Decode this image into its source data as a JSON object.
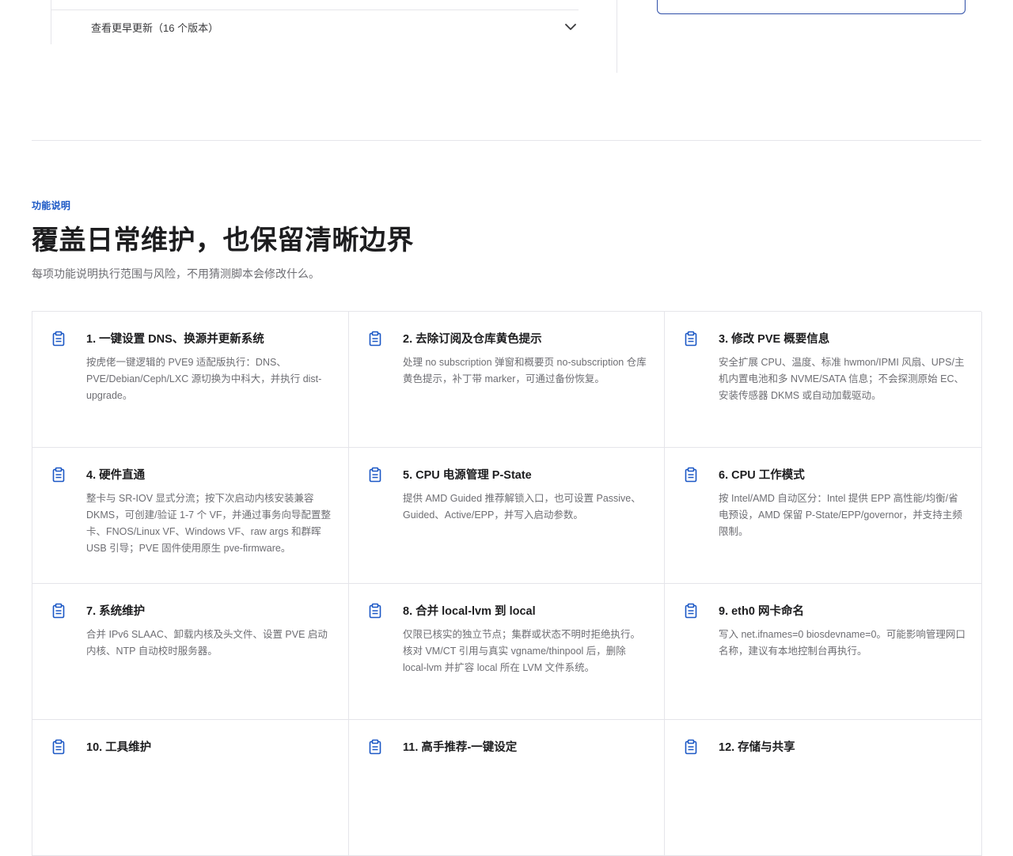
{
  "versions": {
    "older_label": "查看更早更新（16 个版本）",
    "toggle_icon": "chevron-down-icon"
  },
  "features": {
    "eyebrow": "功能说明",
    "title": "覆盖日常维护，也保留清晰边界",
    "subtitle": "每项功能说明执行范围与风险，不用猜测脚本会修改什么。",
    "icon": "clipboard-icon",
    "accent_color": "#1a57c5",
    "cards": [
      {
        "title": "1. 一键设置 DNS、换源并更新系统",
        "desc": "按虎佬一键逻辑的 PVE9 适配版执行：DNS、PVE/Debian/Ceph/LXC 源切换为中科大，并执行 dist-upgrade。"
      },
      {
        "title": "2. 去除订阅及仓库黄色提示",
        "desc": "处理 no subscription 弹窗和概要页 no-subscription 仓库黄色提示，补丁带 marker，可通过备份恢复。"
      },
      {
        "title": "3. 修改 PVE 概要信息",
        "desc": "安全扩展 CPU、温度、标准 hwmon/IPMI 风扇、UPS/主机内置电池和多 NVME/SATA 信息；不会探测原始 EC、安装传感器 DKMS 或自动加载驱动。"
      },
      {
        "title": "4. 硬件直通",
        "desc": "整卡与 SR-IOV 显式分流；按下次启动内核安装兼容 DKMS，可创建/验证 1-7 个 VF，并通过事务向导配置整卡、FNOS/Linux VF、Windows VF、raw args 和群晖 USB 引导；PVE 固件使用原生 pve-firmware。"
      },
      {
        "title": "5. CPU 电源管理 P-State",
        "desc": "提供 AMD Guided 推荐解锁入口，也可设置 Passive、Guided、Active/EPP，并写入启动参数。"
      },
      {
        "title": "6. CPU 工作模式",
        "desc": "按 Intel/AMD 自动区分：Intel 提供 EPP 高性能/均衡/省电预设，AMD 保留 P-State/EPP/governor，并支持主频限制。"
      },
      {
        "title": "7. 系统维护",
        "desc": "合并 IPv6 SLAAC、卸载内核及头文件、设置 PVE 启动内核、NTP 自动校时服务器。"
      },
      {
        "title": "8. 合并 local-lvm 到 local",
        "desc": "仅限已核实的独立节点；集群或状态不明时拒绝执行。核对 VM/CT 引用与真实 vgname/thinpool 后，删除 local-lvm 并扩容 local 所在 LVM 文件系统。"
      },
      {
        "title": "9. eth0 网卡命名",
        "desc": "写入 net.ifnames=0 biosdevname=0。可能影响管理网口名称，建议有本地控制台再执行。"
      },
      {
        "title": "10. 工具维护",
        "desc": ""
      },
      {
        "title": "11. 高手推荐-一键设定",
        "desc": ""
      },
      {
        "title": "12. 存储与共享",
        "desc": ""
      }
    ]
  }
}
